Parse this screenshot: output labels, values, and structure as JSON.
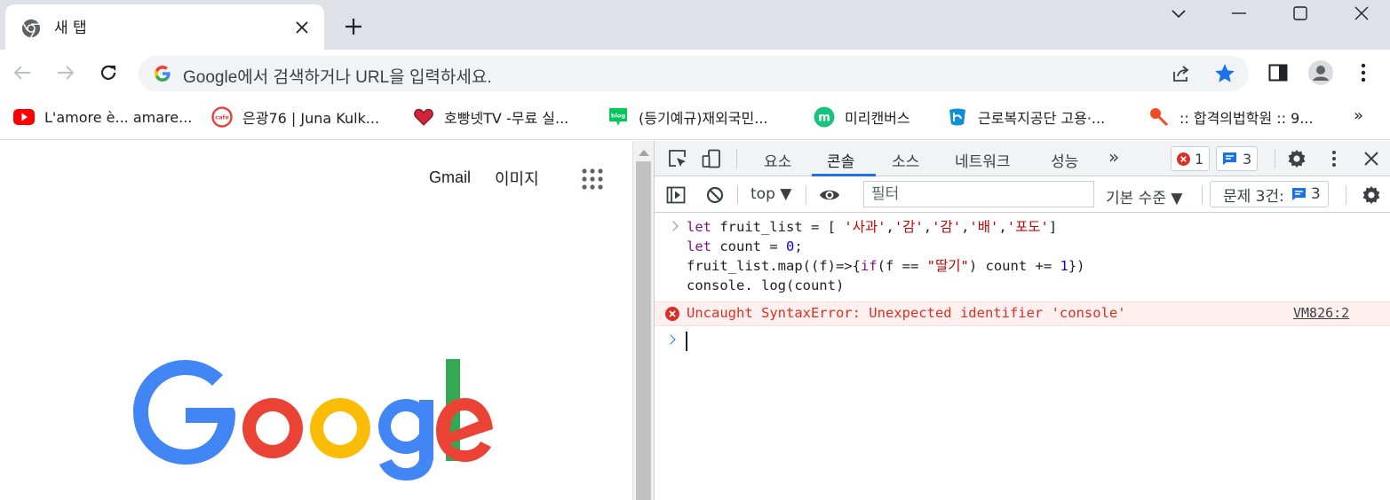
{
  "tab": {
    "title": "새 탭",
    "close_label": "✕"
  },
  "window": {
    "newtab_label": "+"
  },
  "omnibox": {
    "placeholder": "Google에서 검색하거나 URL을 입력하세요."
  },
  "bookmarks": [
    {
      "label": "L'amore è... amare...",
      "icon": "youtube-icon"
    },
    {
      "label": "은광76 | Juna Kulk...",
      "icon": "cafe-icon"
    },
    {
      "label": "호빵넷TV -무료 실...",
      "icon": "heart-icon"
    },
    {
      "label": "(등기예규)재외국민...",
      "icon": "blog-icon",
      "icon_text": "blog"
    },
    {
      "label": "미리캔버스",
      "icon": "miricanvas-icon",
      "icon_text": "m"
    },
    {
      "label": "근로복지공단 고용·...",
      "icon": "comwel-icon"
    },
    {
      "label": ":: 합격의법학원 :: 9...",
      "icon": "pin-icon"
    }
  ],
  "bookmarks_more": "»",
  "page": {
    "gmail": "Gmail",
    "images": "이미지",
    "logo_text": "Google"
  },
  "devtools": {
    "tabs": [
      "요소",
      "콘솔",
      "소스",
      "네트워크",
      "성능"
    ],
    "more_tabs": "»",
    "error_count": "1",
    "issue_count": "3",
    "context": "top ▼",
    "filter_placeholder": "필터",
    "levels": "기본 수준 ▼",
    "issues_label": "문제 3건:",
    "issues_count": "3"
  },
  "console": {
    "line1": {
      "kw": "let",
      "mid": " fruit_list = [ ",
      "s1": "'사과'",
      "s2": "'감'",
      "s3": "'감'",
      "s4": "'배'",
      "s5": "'포도'",
      "end": "]"
    },
    "line2": {
      "kw": "let",
      "mid": " count = ",
      "num": "0",
      "end": ";"
    },
    "line3": {
      "pre": "fruit_list.map((f)=>{",
      "kw": "if",
      "mid": "(f == ",
      "str": "\"딸기\"",
      "mid2": ") count += ",
      "num": "1",
      "end": "})"
    },
    "line4": "console. log(count)",
    "error": "Uncaught SyntaxError: Unexpected identifier 'console'",
    "error_source": "VM826:2"
  },
  "colors": {
    "accent": "#1a73e8",
    "error": "#d93025",
    "star": "#1a73e8"
  }
}
